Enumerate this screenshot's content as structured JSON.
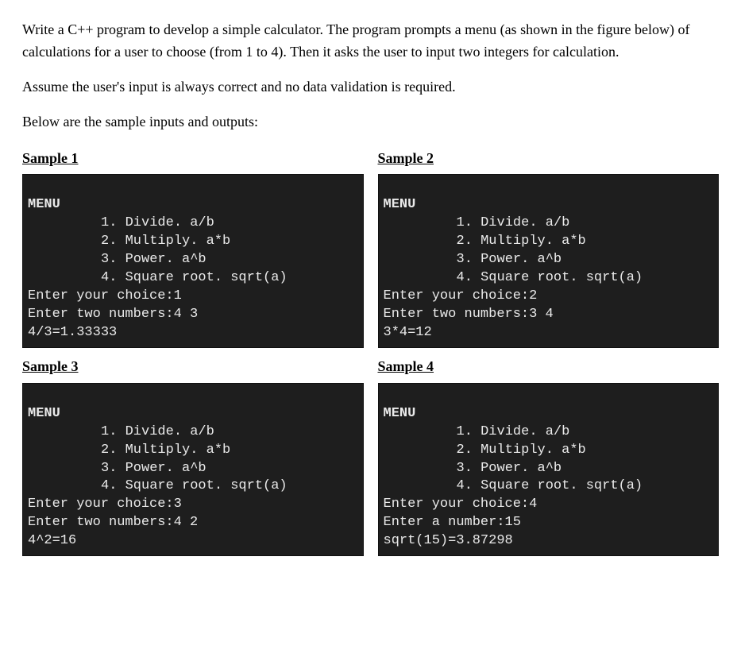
{
  "intro": {
    "p1": "Write a C++ program to develop a simple calculator. The program prompts a menu (as shown in the figure below) of calculations for a user to choose (from 1 to 4). Then it asks the user to input two integers for calculation.",
    "p2": "Assume the user's input is always correct and no data validation is required.",
    "p3": "Below are the sample inputs and outputs:"
  },
  "menu": {
    "title": "MENU",
    "items": [
      "1. Divide. a/b",
      "2. Multiply. a*b",
      "3. Power. a^b",
      "4. Square root. sqrt(a)"
    ]
  },
  "samples": [
    {
      "heading": "Sample 1",
      "lines": [
        "Enter your choice:1",
        "Enter two numbers:4 3",
        "4/3=1.33333"
      ]
    },
    {
      "heading": "Sample 2",
      "lines": [
        "Enter your choice:2",
        "Enter two numbers:3 4",
        "3*4=12"
      ]
    },
    {
      "heading": "Sample 3",
      "lines": [
        "Enter your choice:3",
        "Enter two numbers:4 2",
        "4^2=16"
      ]
    },
    {
      "heading": "Sample 4",
      "lines": [
        "Enter your choice:4",
        "Enter a number:15",
        "sqrt(15)=3.87298"
      ]
    }
  ]
}
